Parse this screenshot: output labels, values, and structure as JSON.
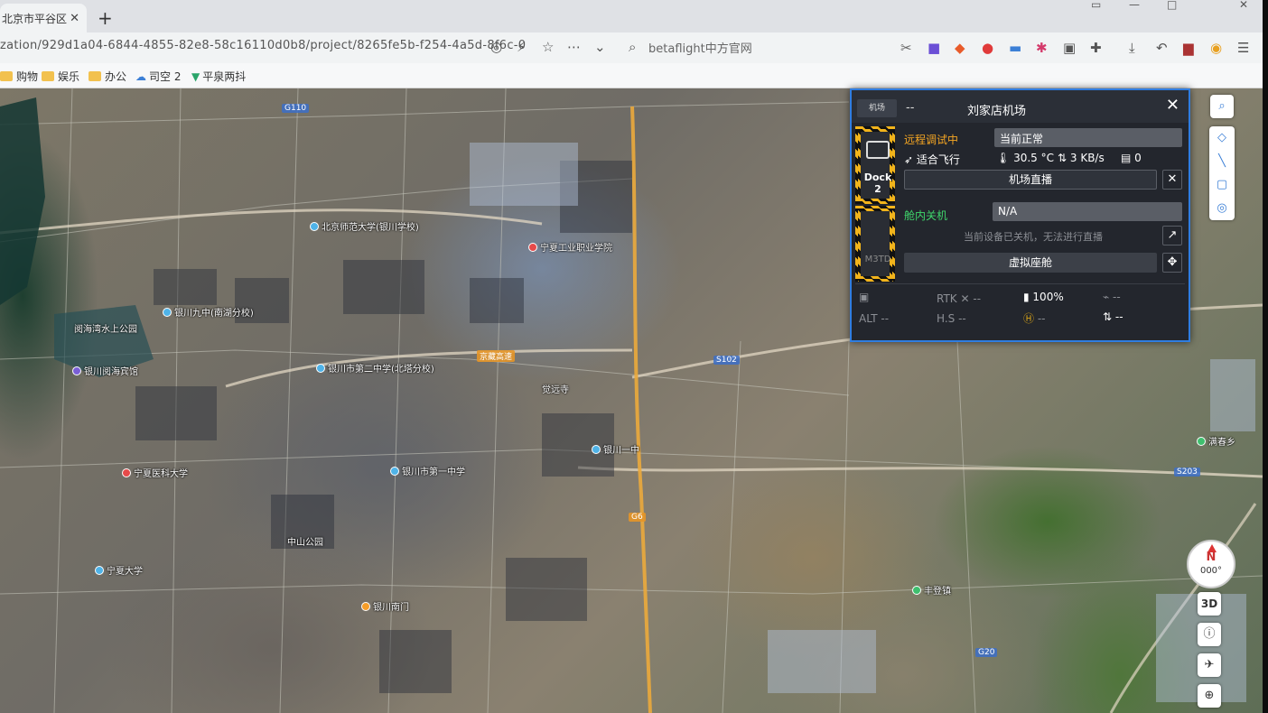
{
  "browser": {
    "tab_title": "北京市平谷区",
    "tab_close": "✕",
    "new_tab": "+",
    "url": "zation/929d1a04-6844-4855-82e8-58c16110d0b8/project/8265fe5b-f254-4a5d-8f6c-0",
    "search_placeholder": "betaflight中方官网",
    "bookmarks": [
      "购物",
      "娱乐",
      "办公",
      "司空 2",
      "平泉两抖"
    ]
  },
  "map": {
    "pois": [
      {
        "name": "北京师范大学(银川学校)",
        "color": "#4fb3e8"
      },
      {
        "name": "银川九中(南湖分校)",
        "color": "#4fb3e8"
      },
      {
        "name": "阅海湾水上公园",
        "color": "#4fb3e8"
      },
      {
        "name": "银川阅海宾馆",
        "color": "#7a5fd6"
      },
      {
        "name": "宁夏工业职业学院",
        "color": "#e64a4a"
      },
      {
        "name": "银川市第二中学(北塔分校)",
        "color": "#4fb3e8"
      },
      {
        "name": "觉远寺",
        "color": "#4fb3e8"
      },
      {
        "name": "银川一中",
        "color": "#4fb3e8"
      },
      {
        "name": "宁夏医科大学",
        "color": "#e64a4a"
      },
      {
        "name": "中山公园",
        "color": "#3fbf6e"
      },
      {
        "name": "银川市第一中学",
        "color": "#4fb3e8"
      },
      {
        "name": "宁夏大学",
        "color": "#4fb3e8"
      },
      {
        "name": "银川南门",
        "color": "#f59d2a"
      },
      {
        "name": "丰登镇",
        "color": "#3fbf6e"
      },
      {
        "name": "满春乡",
        "color": "#3fbf6e"
      }
    ],
    "roads": [
      "G110",
      "S102",
      "S203",
      "京藏高速",
      "G6",
      "G20"
    ]
  },
  "dock_panel": {
    "badge": "机场",
    "dash": "--",
    "title": "刘家店机场",
    "close": "✕",
    "dock_name": "Dock 2",
    "drone_name": "M3TD",
    "dock_status": "远程调试中",
    "dock_state_value": "当前正常",
    "flight_mode": "适合飞行",
    "temperature": "30.5 °C",
    "network_speed": "3 KB/s",
    "storage_count": "0",
    "live_button": "机场直播",
    "drone_status": "舱内关机",
    "drone_state_value": "N/A",
    "drone_hint": "当前设备已关机，无法进行直播",
    "virtual_cockpit_button": "虚拟座舱",
    "rtk_label": "RTK",
    "rtk_value": "--",
    "battery": "100%",
    "alt_label": "ALT",
    "alt_value": "--",
    "hs_label": "H.S",
    "hs_value": "--",
    "h_value": "--",
    "vs_value": "--",
    "signal_value": "--"
  },
  "map_controls": {
    "compass_letter": "N",
    "compass_deg": "000°",
    "view_3d": "3D"
  }
}
